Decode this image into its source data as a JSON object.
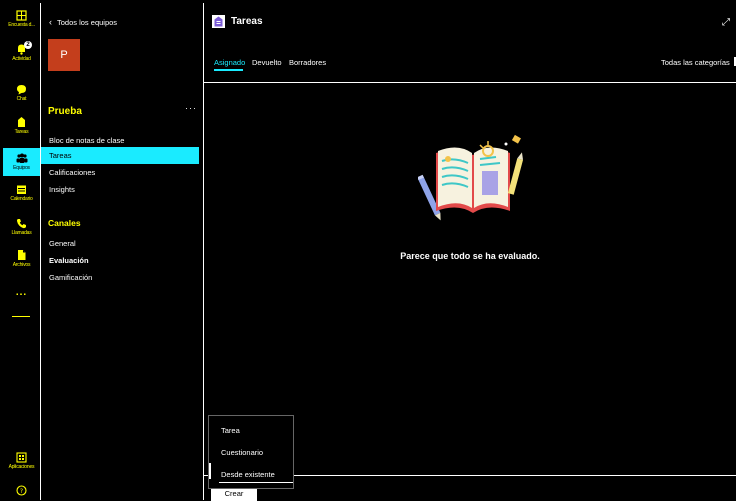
{
  "rail": {
    "items": [
      {
        "label": "Encuesta d...",
        "icon": "poll-icon"
      },
      {
        "label": "Actividad",
        "icon": "bell-icon",
        "badge": "2"
      },
      {
        "label": "Chat",
        "icon": "chat-icon"
      },
      {
        "label": "Tareas",
        "icon": "assignments-icon"
      },
      {
        "label": "Equipos",
        "icon": "teams-icon"
      },
      {
        "label": "Calendario",
        "icon": "calendar-icon"
      },
      {
        "label": "Llamadas",
        "icon": "phone-icon"
      },
      {
        "label": "Archivos",
        "icon": "file-icon"
      }
    ],
    "more": "...",
    "apps_label": "Aplicaciones"
  },
  "panel": {
    "back_label": "Todos los equipos",
    "team_initial": "P",
    "team_name": "Prueba",
    "more": "···",
    "items": [
      "Bloc de notas de clase",
      "Tareas",
      "Calificaciones",
      "Insights"
    ],
    "channels_heading": "Canales",
    "channels": [
      "General",
      "Evaluación",
      "Gamificación"
    ]
  },
  "main": {
    "title": "Tareas",
    "tabs": [
      "Asignado",
      "Devuelto",
      "Borradores"
    ],
    "categories_label": "Todas las categorías",
    "empty_message": "Parece que todo se ha evaluado.",
    "create_label": "Crear",
    "create_menu": [
      "Tarea",
      "Cuestionario",
      "Desde existente"
    ]
  },
  "colors": {
    "accent": "#1aebff",
    "highlight": "#ffff00",
    "team_avatar": "#c43e1c",
    "background": "#000000"
  }
}
